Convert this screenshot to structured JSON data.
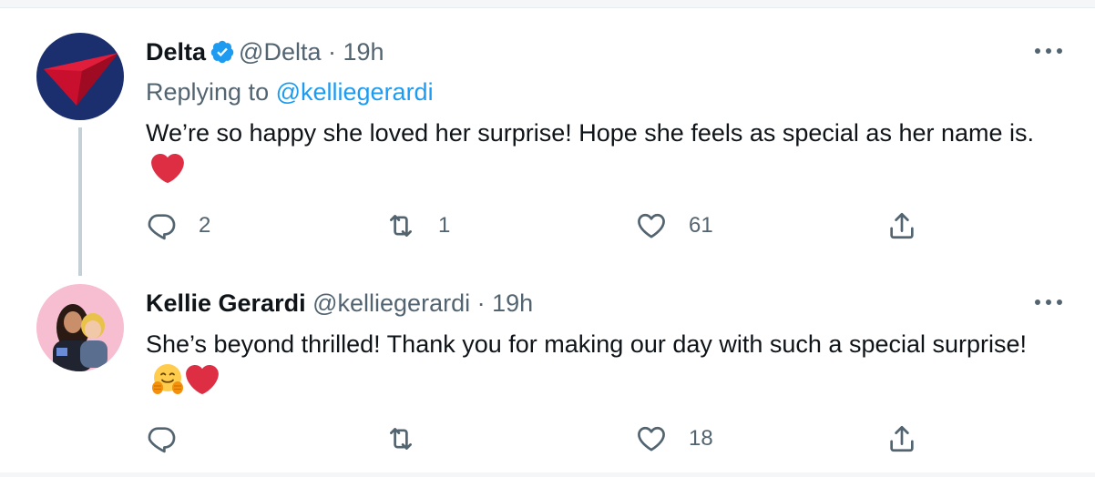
{
  "tweets": [
    {
      "name": "Delta",
      "verified": true,
      "handle": "@Delta",
      "dot": "·",
      "time": "19h",
      "replying_prefix": "Replying to ",
      "replying_handle": "@kelliegerardi",
      "text": "We’re so happy she loved her surprise! Hope she feels as special as her name is.",
      "emojis": [
        "red-heart"
      ],
      "actions": {
        "reply": "2",
        "retweet": "1",
        "like": "61"
      }
    },
    {
      "name": "Kellie Gerardi",
      "verified": false,
      "handle": "@kelliegerardi",
      "dot": "·",
      "time": "19h",
      "text": "She’s beyond thrilled! Thank you for making our day with such a special surprise!",
      "emojis": [
        "hugging-face",
        "red-heart"
      ],
      "actions": {
        "reply": "",
        "retweet": "",
        "like": "18"
      }
    }
  ],
  "colors": {
    "accent": "#1d9bf0",
    "secondary_text": "#536471",
    "delta_navy": "#1b2f6e",
    "delta_red": "#c8102e",
    "heart": "#dd2e44"
  }
}
